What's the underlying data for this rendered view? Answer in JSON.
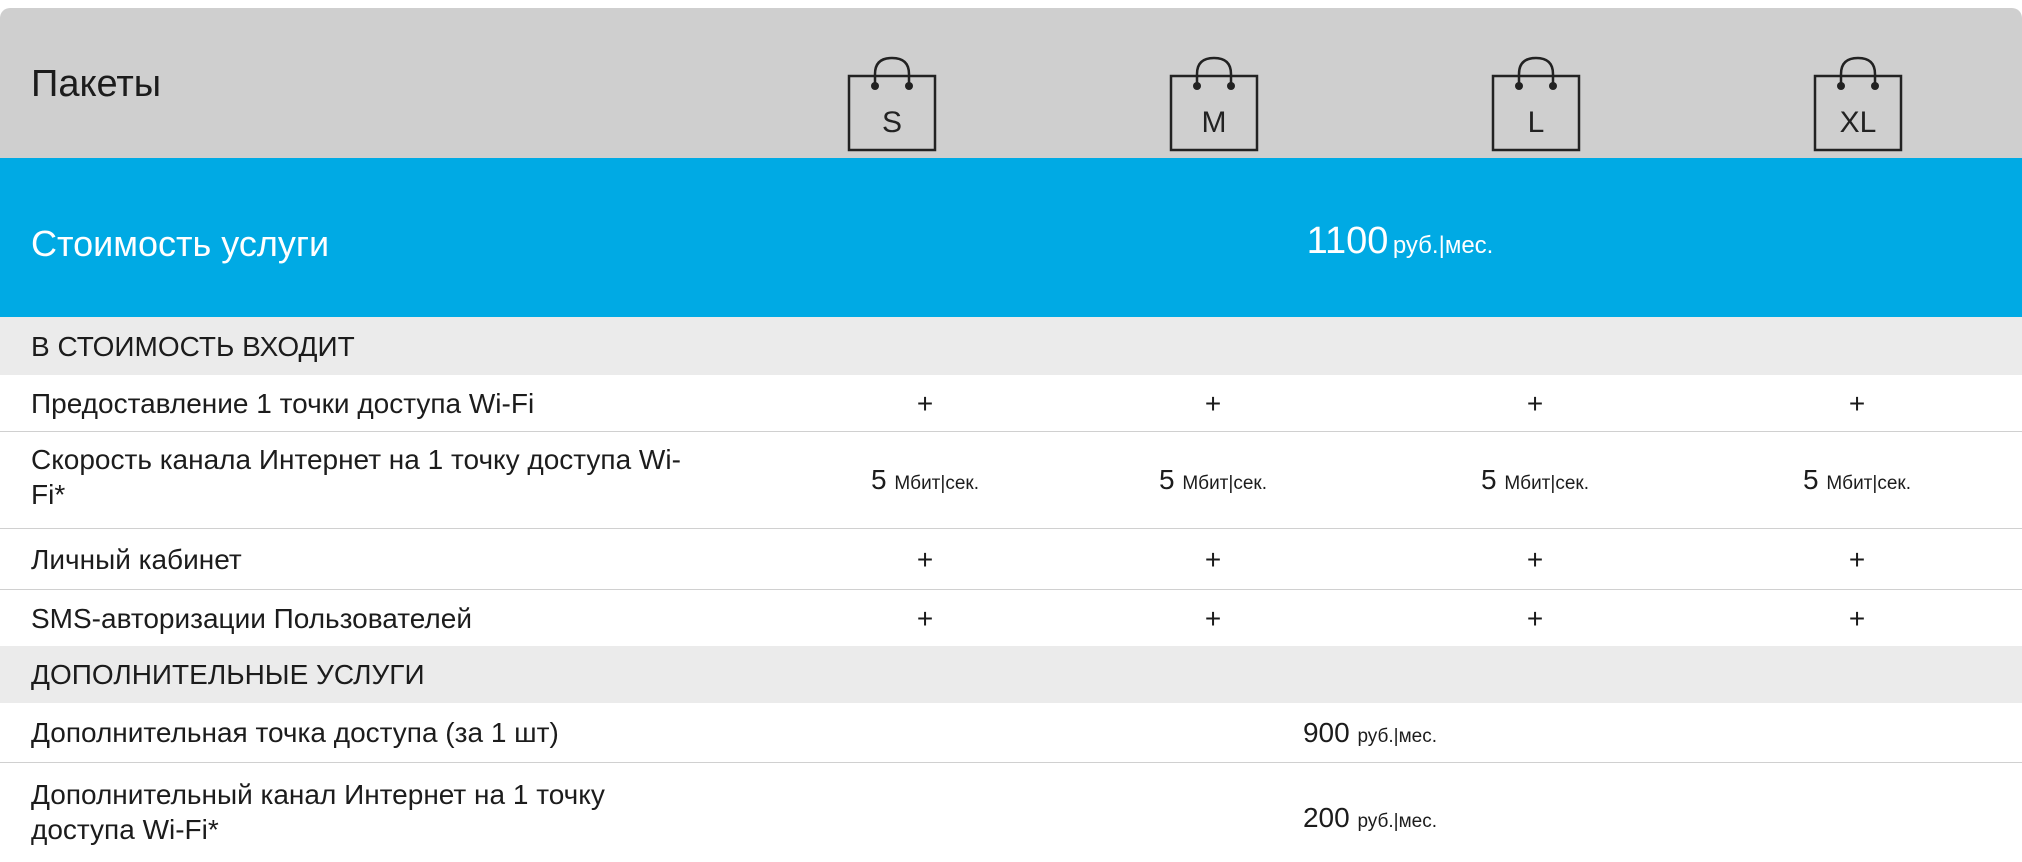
{
  "colors": {
    "header_bg": "#cfcfcf",
    "price_bg": "#00aae4",
    "section_bg": "#ebebeb",
    "text": "#1c1c1c",
    "white": "#ffffff"
  },
  "header": {
    "title": "Пакеты",
    "packages": [
      {
        "label": "S",
        "icon": "shopping-bag-icon"
      },
      {
        "label": "M",
        "icon": "shopping-bag-icon"
      },
      {
        "label": "L",
        "icon": "shopping-bag-icon"
      },
      {
        "label": "XL",
        "icon": "shopping-bag-icon"
      }
    ]
  },
  "price": {
    "label": "Стоимость услуги",
    "value": "1100",
    "unit": "руб.|мес."
  },
  "included": {
    "title": "В СТОИМОСТЬ ВХОДИТ",
    "rows": [
      {
        "label": "Предоставление 1 точки доступа Wi-Fi",
        "cells": [
          "+",
          "+",
          "+",
          "+"
        ]
      },
      {
        "label_line1": "Скорость канала Интернет на 1 точку доступа Wi-",
        "label_line2": "Fi*",
        "value": "5",
        "unit": "Мбит|сек."
      },
      {
        "label": "Личный кабинет",
        "cells": [
          "+",
          "+",
          "+",
          "+"
        ]
      },
      {
        "label": "SMS-авторизации Пользователей",
        "cells": [
          "+",
          "+",
          "+",
          "+"
        ]
      }
    ]
  },
  "extra": {
    "title": "ДОПОЛНИТЕЛЬНЫЕ УСЛУГИ",
    "rows": [
      {
        "label": "Дополнительная точка доступа (за 1 шт)",
        "value": "900",
        "unit": "руб.|мес."
      },
      {
        "label_line1": "Дополнительный канал Интернет на 1 точку",
        "label_line2": "доступа Wi-Fi*",
        "value": "200",
        "unit": "руб.|мес."
      }
    ]
  }
}
